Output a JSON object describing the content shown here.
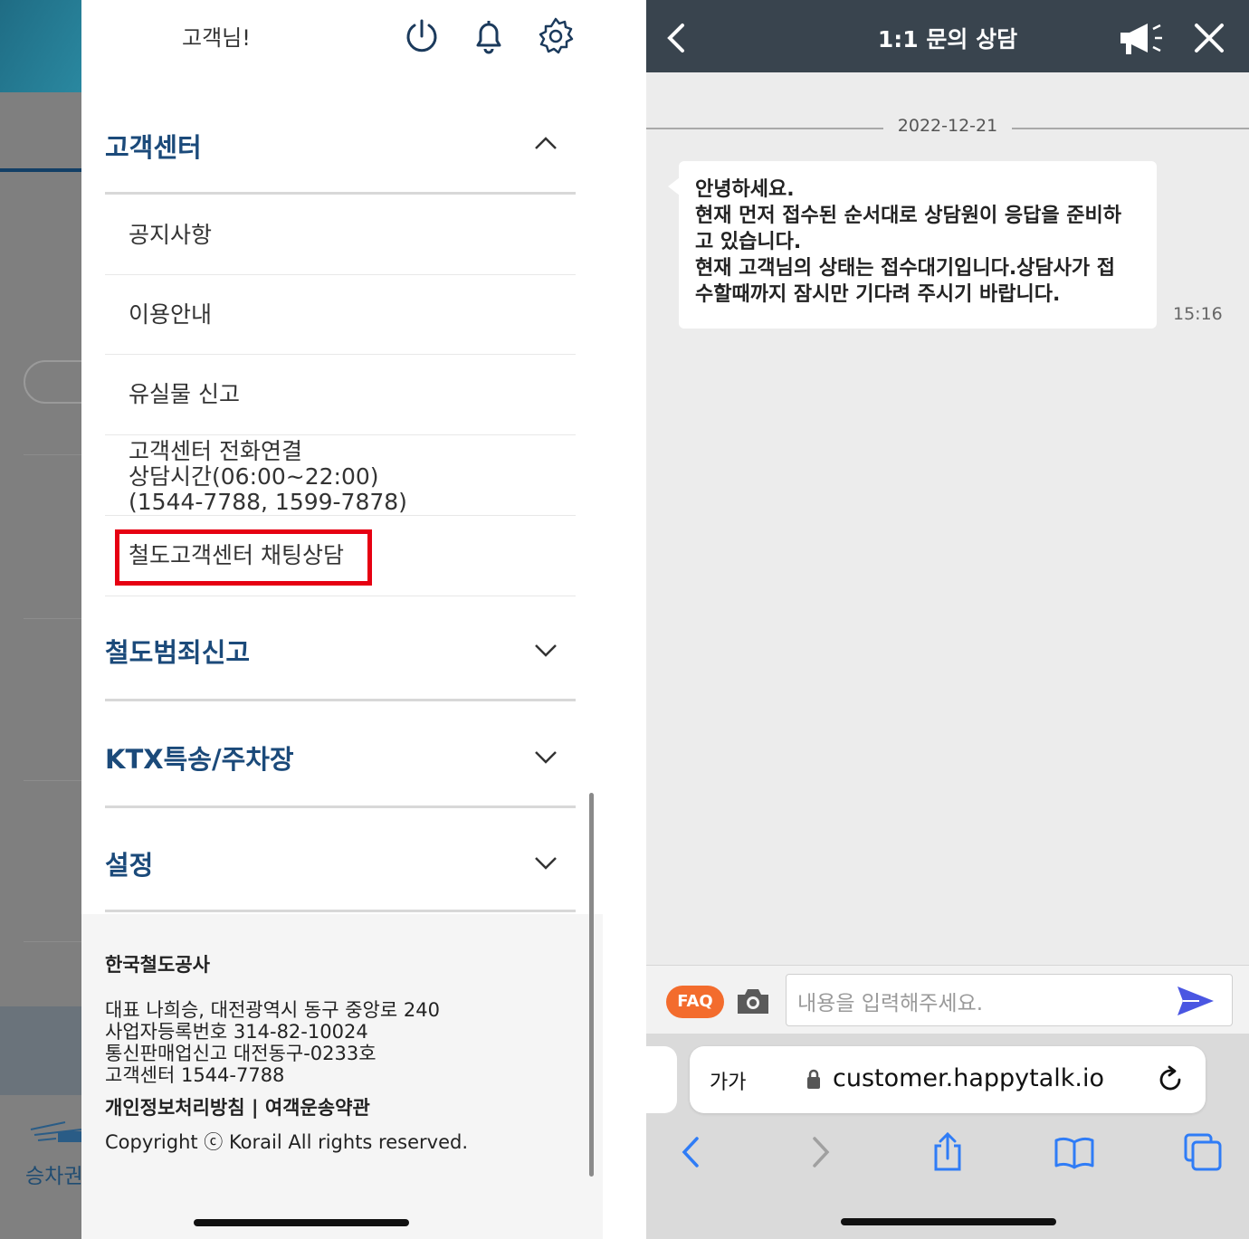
{
  "drawer": {
    "greeting": "고객님!",
    "icons": {
      "power": "power-icon",
      "bell": "bell-icon",
      "settings": "gear-icon"
    },
    "sections": [
      {
        "title": "고객센터",
        "expanded": true,
        "items": [
          "공지사항",
          "이용안내",
          "유실물 신고",
          "고객센터 전화연결",
          "상담시간(06:00~22:00)",
          "(1544-7788, 1599-7878)",
          "철도고객센터 채팅상담"
        ]
      },
      {
        "title": "철도범죄신고",
        "expanded": false
      },
      {
        "title": "KTX특송/주차장",
        "expanded": false
      },
      {
        "title": "설정",
        "expanded": false
      }
    ],
    "footer": {
      "company": "한국철도공사",
      "lines": [
        "대표 나희승, 대전광역시 동구 중앙로 240",
        "사업자등록번호 314-82-10024",
        "통신판매업신고 대전동구-0233호",
        "고객센터 1544-7788"
      ],
      "links": "개인정보처리방침 | 여객운송약관",
      "copyright": "Copyright ⓒ Korail All rights reserved."
    },
    "highlight_color": "#e60012"
  },
  "background_app": {
    "tab_label": "승차권"
  },
  "chat": {
    "title": "1:1 문의 상담",
    "date": "2022-12-21",
    "message_lines": [
      "안녕하세요.",
      "현재 먼저 접수된 순서대로 상담원이 응답을 준비하",
      "고 있습니다.",
      "현재 고객님의 상태는 접수대기입니다.상담사가 접",
      "수할때까지 잠시만 기다려 주시기 바랍니다."
    ],
    "message_time": "15:16",
    "faq_label": "FAQ",
    "input_placeholder": "내용을 입력해주세요.",
    "header_color": "#39444e",
    "faq_color": "#f36c2d",
    "send_color": "#4a56e2"
  },
  "browser": {
    "text_size_label": "가가",
    "url": "customer.happytalk.io"
  }
}
